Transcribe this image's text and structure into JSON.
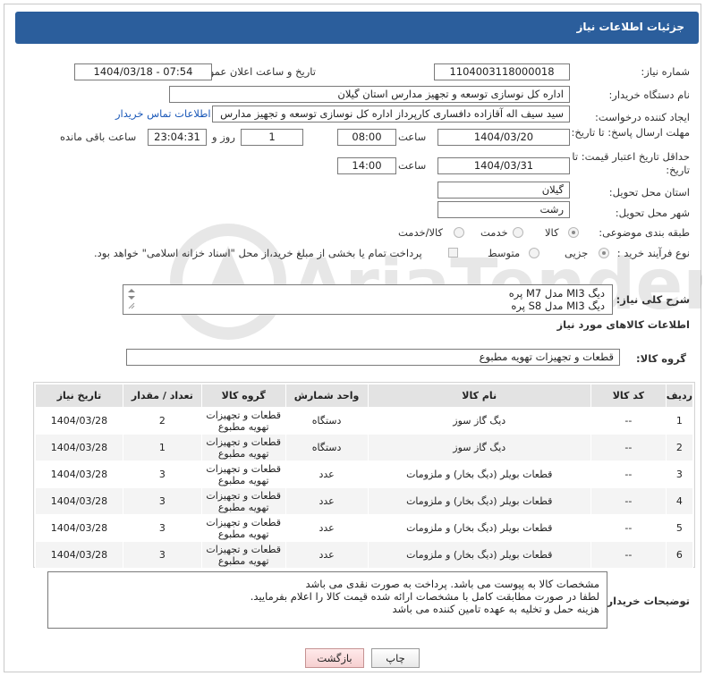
{
  "header": {
    "title": "جزئیات اطلاعات نیاز"
  },
  "labels": {
    "need_number": "شماره نیاز:",
    "announce_datetime": "تاریخ و ساعت اعلان عمومی:",
    "buyer_org": "نام دستگاه خریدار:",
    "requester": "ایجاد کننده درخواست:",
    "reply_deadline": "مهلت ارسال پاسخ: تا تاریخ:",
    "price_validity": "حداقل تاریخ اعتبار قیمت: تا تاریخ:",
    "time": "ساعت",
    "day_and": "روز و",
    "time_remaining": "ساعت باقی مانده",
    "province": "استان محل تحویل:",
    "city": "شهر محل تحویل:",
    "category": "طبقه بندی موضوعی:",
    "purchase_type": "نوع فرآیند خرید :",
    "general_desc": "شرح کلی نیاز:",
    "goods_info": "اطلاعات کالاهای مورد نیاز",
    "goods_group": "گروه کالا:",
    "buyer_notes": "توضیحات خریدار:"
  },
  "values": {
    "need_number": "1104003118000018",
    "announce_datetime": "1404/03/18 - 07:54",
    "buyer_org": "اداره کل نوسازی  توسعه و تجهیز مدارس استان گیلان",
    "requester": "سید سیف اله آقازاده دافساری کارپرداز اداره کل نوسازی  توسعه و تجهیز مدارس",
    "contact_link": "اطلاعات تماس خریدار",
    "reply_date": "1404/03/20",
    "reply_time": "08:00",
    "days": "1",
    "remaining_time": "23:04:31",
    "validity_date": "1404/03/31",
    "validity_time": "14:00",
    "province": "گیلان",
    "city": "رشت",
    "goods_group": "قطعات و تجهیزات تهویه مطبوع"
  },
  "category_options": [
    {
      "label": "کالا",
      "selected": true
    },
    {
      "label": "خدمت",
      "selected": false
    },
    {
      "label": "کالا/خدمت",
      "selected": false
    }
  ],
  "purchase_options": [
    {
      "label": "جزیی",
      "selected": true
    },
    {
      "label": "متوسط",
      "selected": false
    }
  ],
  "payment_note": "پرداخت تمام یا بخشی از مبلغ خرید،از محل \"اسناد خزانه اسلامی\" خواهد بود.",
  "general_desc_lines": [
    "دیگ MI3 مدل M7 پره",
    "دیگ MI3 مدل S8 پره"
  ],
  "table": {
    "headers": [
      "ردیف",
      "کد کالا",
      "نام کالا",
      "واحد شمارش",
      "گروه کالا",
      "تعداد / مقدار",
      "تاریخ نیاز"
    ],
    "rows": [
      {
        "index": "1",
        "code": "--",
        "name": "دیگ گاز سوز",
        "unit": "دستگاه",
        "group": "قطعات و تجهیزات تهویه مطبوع",
        "qty": "2",
        "date": "1404/03/28"
      },
      {
        "index": "2",
        "code": "--",
        "name": "دیگ گاز سوز",
        "unit": "دستگاه",
        "group": "قطعات و تجهیزات تهویه مطبوع",
        "qty": "1",
        "date": "1404/03/28"
      },
      {
        "index": "3",
        "code": "--",
        "name": "قطعات بویلر (دیگ بخار) و ملزومات",
        "unit": "عدد",
        "group": "قطعات و تجهیزات تهویه مطبوع",
        "qty": "3",
        "date": "1404/03/28"
      },
      {
        "index": "4",
        "code": "--",
        "name": "قطعات بویلر (دیگ بخار) و ملزومات",
        "unit": "عدد",
        "group": "قطعات و تجهیزات تهویه مطبوع",
        "qty": "3",
        "date": "1404/03/28"
      },
      {
        "index": "5",
        "code": "--",
        "name": "قطعات بویلر (دیگ بخار) و ملزومات",
        "unit": "عدد",
        "group": "قطعات و تجهیزات تهویه مطبوع",
        "qty": "3",
        "date": "1404/03/28"
      },
      {
        "index": "6",
        "code": "--",
        "name": "قطعات بویلر (دیگ بخار) و ملزومات",
        "unit": "عدد",
        "group": "قطعات و تجهیزات تهویه مطبوع",
        "qty": "3",
        "date": "1404/03/28"
      }
    ]
  },
  "buyer_notes_lines": [
    "مشخصات کالا به پیوست می باشد. پرداخت به صورت نقدی می باشد",
    "لطفا در صورت مطابقت کامل با مشخصات ارائه شده قیمت کالا را اعلام بفرمایید.",
    "هزینه حمل و تخلیه به عهده تامین کننده می باشد"
  ],
  "buttons": {
    "print": "چاپ",
    "back": "بازگشت"
  },
  "watermark_text": "AriaTender.neT",
  "colors": {
    "header": "#2b5e9c",
    "link": "#1a58b8",
    "back_button": "#f6cfd0"
  }
}
